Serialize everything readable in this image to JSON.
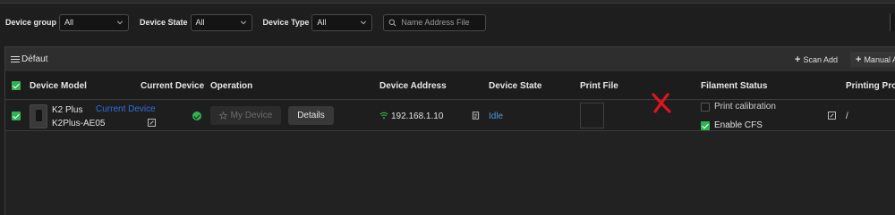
{
  "filters": {
    "device_group_label": "Device group",
    "device_group_value": "All",
    "device_state_label": "Device State",
    "device_state_value": "All",
    "device_type_label": "Device Type",
    "device_type_value": "All",
    "search_placeholder": "Name Address File"
  },
  "toolbar": {
    "group_name": "Défaut",
    "scan_add_label": "Scan Add",
    "manual_add_label": "Manual A"
  },
  "table": {
    "headers": {
      "device_model": "Device Model",
      "current_device": "Current Device",
      "operation": "Operation",
      "device_address": "Device Address",
      "device_state": "Device State",
      "print_file": "Print File",
      "filament_status": "Filament Status",
      "printing_progress": "Printing Prog"
    },
    "rows": [
      {
        "model": "K2 Plus",
        "current_device_tag": "Current Device",
        "device_name": "K2Plus-AE05",
        "my_device_label": "My Device",
        "details_label": "Details",
        "address": "192.168.1.10",
        "state": "Idle",
        "print_calibration_label": "Print calibration",
        "enable_cfs_label": "Enable CFS",
        "progress": "/"
      }
    ]
  },
  "colors": {
    "accent_green": "#2fb352",
    "current_device_blue": "#2f6fe0",
    "idle_blue": "#4a9bd8",
    "mark_red": "#e0141e"
  },
  "icons": [
    "chevron-down-icon",
    "search-icon",
    "list-icon",
    "plus-icon",
    "edit-icon",
    "check-circle-icon",
    "star-icon",
    "wifi-icon",
    "copy-icon",
    "red-x-mark"
  ]
}
